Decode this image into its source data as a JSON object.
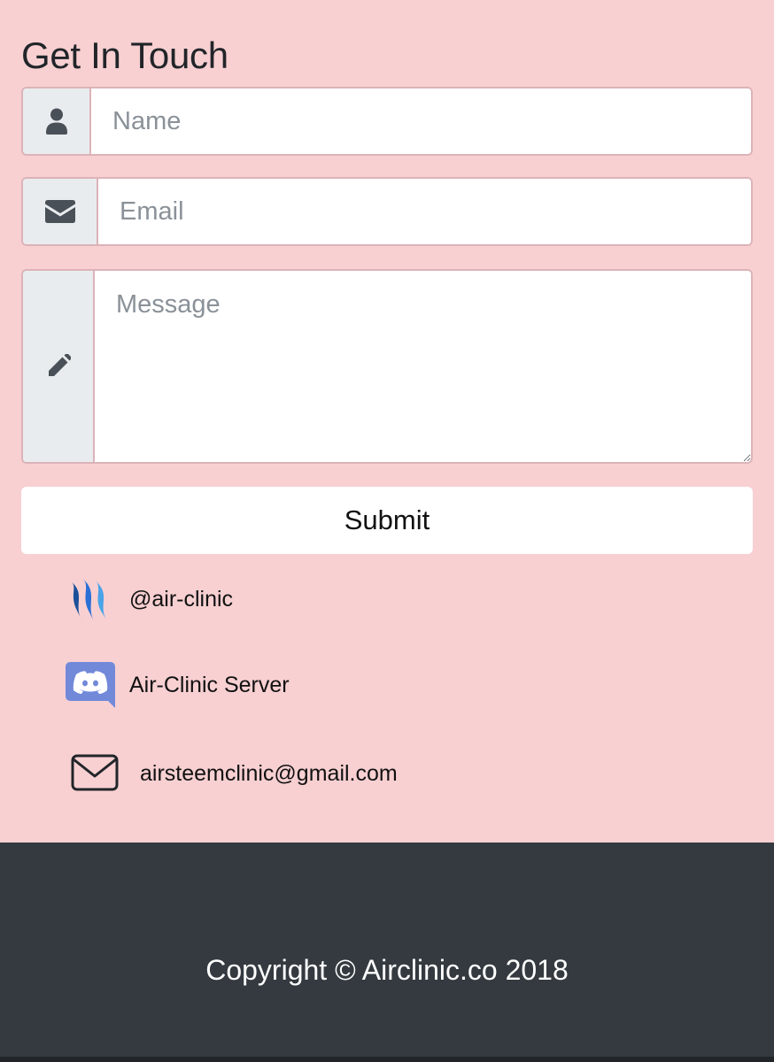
{
  "form": {
    "title": "Get In Touch",
    "name_placeholder": "Name",
    "email_placeholder": "Email",
    "message_placeholder": "Message",
    "submit_label": "Submit",
    "name_icon": "user-icon",
    "email_icon": "envelope-icon",
    "message_icon": "pencil-icon"
  },
  "contacts": [
    {
      "icon": "steemit-icon",
      "label": "@air-clinic"
    },
    {
      "icon": "discord-icon",
      "label": "Air-Clinic Server"
    },
    {
      "icon": "mail-outline-icon",
      "label": "airsteemclinic@gmail.com"
    }
  ],
  "footer": {
    "copyright": "Copyright © Airclinic.co 2018"
  },
  "colors": {
    "page_background": "#f8d0d2",
    "footer_background": "#343a40",
    "input_border": "#dcb3b8",
    "discord_brand": "#7289da",
    "steemit_brand": "#1a5099"
  }
}
